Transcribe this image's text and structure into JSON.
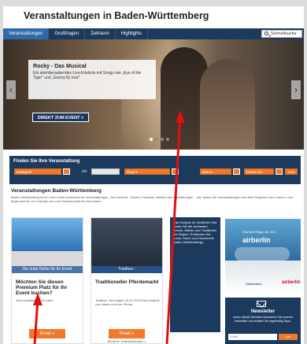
{
  "site": {
    "title": "Veranstaltungen in Baden-Württemberg"
  },
  "nav": {
    "items": [
      "Veranstaltungen",
      "Großfragen",
      "Zeitraum",
      "Highlights"
    ],
    "search_label": "Schnellsuche"
  },
  "hero": {
    "title": "Rocky - Das Musical",
    "text": "Ein atemberaubendes Live-Erlebnis mit Songs wie „Eye of the Tiger\" und „Gonna fly now\"",
    "button": "DIREKT ZUM EVENT >"
  },
  "finder": {
    "title": "Finden Sie Ihre Veranstaltung",
    "category_placeholder": "Kategorie",
    "from_label": "Ort",
    "region_placeholder": "Region",
    "date_label": "Datum",
    "date_to_label": "Datum bis",
    "search_button": "Los"
  },
  "intro": {
    "heading": "Veranstaltungen Baden-Württemberg",
    "text": "Baden-Württemberg ist ein Land voller sehenswerter Veranstaltungen. Ob Konzerte, Theater, Festivals, Märkte oder Ausstellungen – hier finden Sie Veranstaltungen aus allen Regionen des Landes, vom Bodensee bis zur Kurpfalz und vom Schwarzwald bis Hohenlohe."
  },
  "cards": [
    {
      "caption": "Die erste Reihe für Ihr Event",
      "title": "Möchten Sie diesen Premium Platz für Ihr Event buchen?",
      "meta": "Jetzt kontaktieren für mehr",
      "button": "Detail >",
      "footer": ""
    },
    {
      "caption": "Tradition :",
      "title": "Traditioneller Pferdemarkt",
      "meta": "Tradition: Kirchingen 18.02.2016 Das Ereignis vom Markt rund um Pferde.",
      "button": "Detail >",
      "footer": "Ähnliche Veranstaltungen »"
    }
  ],
  "column_text": "Das Ereignis fur Genießer! Hier finden Sie die schönsten Events, Märkte und Traditionen der Region. Entdecken Sie Kunst, Kultur und Geschichte Baden-Württembergs.",
  "ad": {
    "brand": "airberlin",
    "tagline": "Fast fünf Flüge. Ab 40 €",
    "partner1": "Stauferland",
    "partner2": "airberlin"
  },
  "newsletter": {
    "title": "Newsletter",
    "text": "Immer aktuell informiert! Abonnieren Sie unseren Newsletter und erhalten Sie regelmäßig Tipps.",
    "input_placeholder": "E-Mail",
    "button": "Los"
  },
  "colors": {
    "nav": "#1c3a5e",
    "accent": "#f07a2a",
    "annotation": "#e01010"
  }
}
